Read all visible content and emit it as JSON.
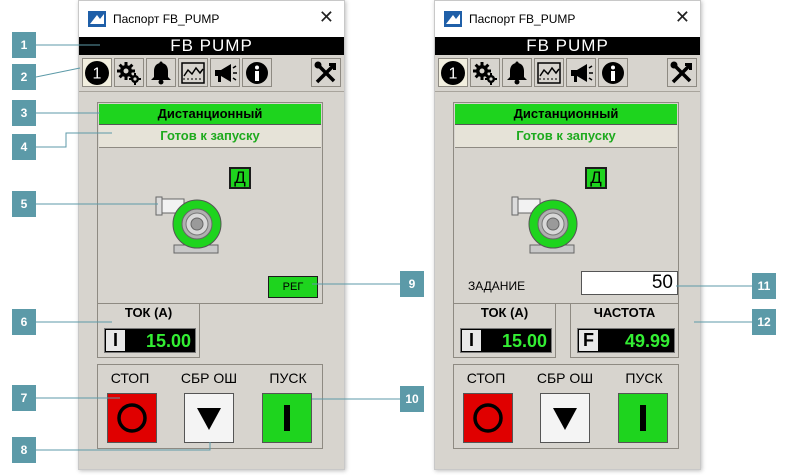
{
  "windows": [
    {
      "title": "Паспорт FB_PUMP",
      "header": "FB  PUMP",
      "toolbar": {
        "page_number": "1"
      },
      "mode": "Дистанционный",
      "state": "Готов к запуску",
      "indicator": "Д",
      "reg_button": "РЕГ",
      "current": {
        "title": "ТОК (А)",
        "tag": "I",
        "value": "15.00"
      },
      "commands": {
        "stop": "СТОП",
        "reset": "СБР ОШ",
        "start": "ПУСК"
      }
    },
    {
      "title": "Паспорт FB_PUMP",
      "header": "FB  PUMP",
      "toolbar": {
        "page_number": "1"
      },
      "mode": "Дистанционный",
      "state": "Готов к запуску",
      "indicator": "Д",
      "setpoint": {
        "label": "ЗАДАНИЕ",
        "value": "50"
      },
      "current": {
        "title": "ТОК (А)",
        "tag": "I",
        "value": "15.00"
      },
      "frequency": {
        "title": "ЧАСТОТА",
        "tag": "F",
        "value": "49.99"
      },
      "commands": {
        "stop": "СТОП",
        "reset": "СБР ОШ",
        "start": "ПУСК"
      }
    }
  ],
  "callouts": [
    "1",
    "2",
    "3",
    "4",
    "5",
    "6",
    "7",
    "8",
    "9",
    "10",
    "11",
    "12"
  ],
  "colors": {
    "running_green": "#1ed41e",
    "stop_red": "#e00000",
    "callout": "#5c9aa8",
    "panel": "#d7d4ce"
  },
  "icons": [
    "page-1-icon",
    "gears-icon",
    "bell-icon",
    "trend-icon",
    "megaphone-icon",
    "info-icon",
    "tools-icon"
  ]
}
